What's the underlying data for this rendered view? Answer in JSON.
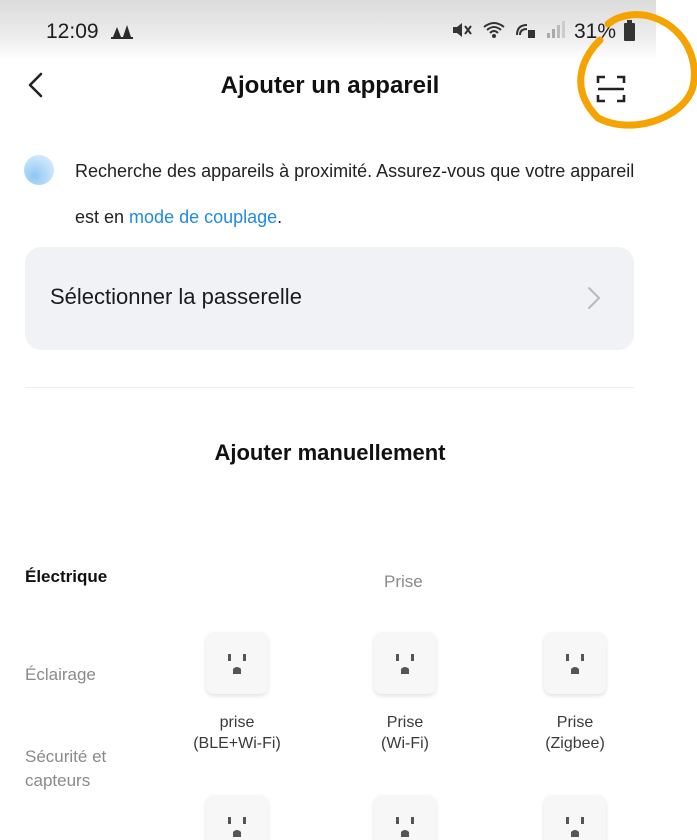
{
  "status_bar": {
    "time": "12:09",
    "battery": "31%",
    "icons": [
      "notification-icon",
      "mute-icon",
      "wifi-icon",
      "wifi-calling-icon",
      "signal-icon",
      "battery-icon"
    ]
  },
  "header": {
    "title": "Ajouter un appareil",
    "back_icon": "chevron-left-icon",
    "scan_icon": "scan-icon"
  },
  "search": {
    "text_before_link": "Recherche des appareils à proximité. Assurez-vous que votre appareil est en ",
    "link": "mode de couplage",
    "text_after_link": "."
  },
  "gateway": {
    "label": "Sélectionner la passerelle"
  },
  "manual": {
    "title": "Ajouter manuellement",
    "categories": [
      {
        "label": "Électrique",
        "active": true
      },
      {
        "label": "Éclairage",
        "active": false
      },
      {
        "label": "Sécurité et\ncapteurs",
        "active": false
      }
    ],
    "subcategory": "Prise",
    "devices": [
      {
        "name": "prise\n(BLE+Wi-Fi)"
      },
      {
        "name": "Prise\n(Wi-Fi)"
      },
      {
        "name": "Prise\n(Zigbee)"
      },
      {
        "name": ""
      },
      {
        "name": ""
      },
      {
        "name": ""
      }
    ]
  },
  "colors": {
    "accent_link": "#1f8be5",
    "annotation": "#f5a300",
    "card_background": "#f1f2f6"
  }
}
